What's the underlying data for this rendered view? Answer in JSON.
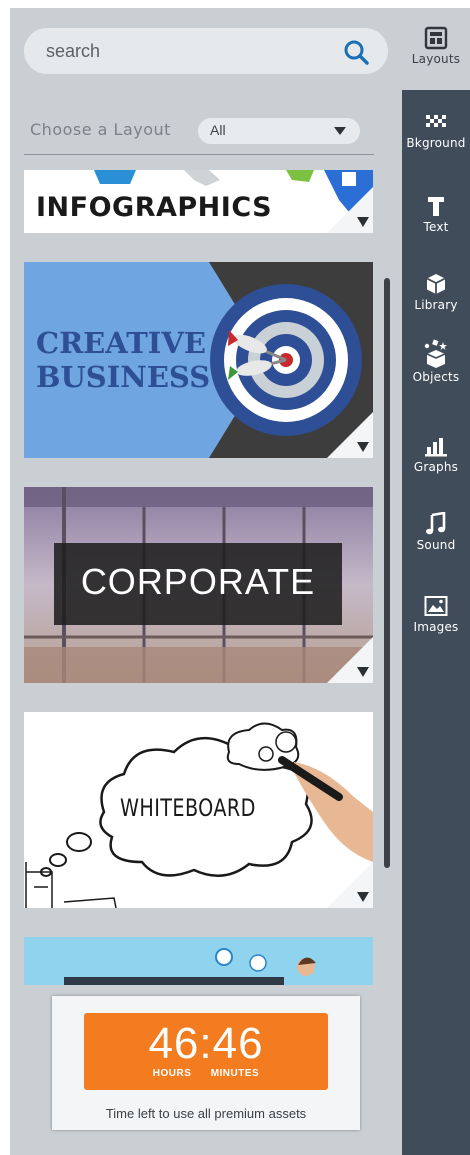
{
  "search": {
    "placeholder": "search"
  },
  "layout_filter": {
    "label": "Choose a Layout",
    "selected": "All"
  },
  "layouts": [
    {
      "title": "INFOGRAPHICS"
    },
    {
      "title_line1": "CREATIVE",
      "title_line2": "BUSINESS"
    },
    {
      "title": "CORPORATE"
    },
    {
      "title": "WHITEBOARD"
    },
    {
      "title": ""
    }
  ],
  "timer": {
    "time": "46:46",
    "hours_label": "HOURS",
    "minutes_label": "MINUTES",
    "caption": "Time left to use all premium assets"
  },
  "toolbar": [
    {
      "label": "Layouts",
      "icon": "layouts-icon"
    },
    {
      "label": "Bkground",
      "icon": "background-icon"
    },
    {
      "label": "Text",
      "icon": "text-icon"
    },
    {
      "label": "Library",
      "icon": "library-icon"
    },
    {
      "label": "Objects",
      "icon": "objects-icon"
    },
    {
      "label": "Graphs",
      "icon": "graphs-icon"
    },
    {
      "label": "Sound",
      "icon": "sound-icon"
    },
    {
      "label": "Images",
      "icon": "images-icon"
    }
  ],
  "colors": {
    "panel": "#c9cfd3",
    "sidebar": "#404c59",
    "accent": "#f47c20",
    "search_icon": "#1b6fb5"
  }
}
